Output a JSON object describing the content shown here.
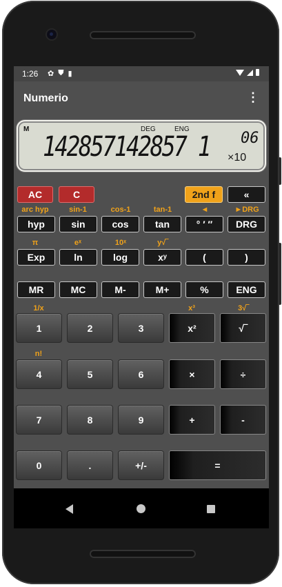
{
  "status": {
    "time": "1:26",
    "icons": [
      "gear-icon",
      "shield-icon",
      "sd-card-icon"
    ]
  },
  "app": {
    "title": "Numerio",
    "menu": "⋮"
  },
  "display": {
    "memory": "M",
    "angle_mode": "DEG",
    "format_mode": "ENG",
    "value": "142857142857 1",
    "exponent": "06",
    "times_ten": "×10"
  },
  "keys": {
    "ac": "AC",
    "c": "C",
    "second_f": "2nd f",
    "backspace": "«",
    "hyp": "hyp",
    "sin": "sin",
    "cos": "cos",
    "tan": "tan",
    "dms": "° ′ ″",
    "drg": "DRG",
    "exp": "Exp",
    "ln": "ln",
    "log": "log",
    "xy": "xʸ",
    "lparen": "(",
    "rparen": ")",
    "mr": "MR",
    "mc": "MC",
    "mminus": "M-",
    "mplus": "M+",
    "percent": "%",
    "eng": "ENG",
    "d1": "1",
    "d2": "2",
    "d3": "3",
    "sq": "x²",
    "sqrt": "√‾",
    "d4": "4",
    "d5": "5",
    "d6": "6",
    "mul": "×",
    "div": "÷",
    "d7": "7",
    "d8": "8",
    "d9": "9",
    "add": "+",
    "sub": "-",
    "d0": "0",
    "dot": ".",
    "neg": "+/-",
    "eq": "="
  },
  "second_labels": {
    "arc_hyp": "arc hyp",
    "sin_inv": "sin-1",
    "cos_inv": "cos-1",
    "tan_inv": "tan-1",
    "dms_back": "◄",
    "drg_to": "►DRG",
    "pi": "π",
    "ex": "eˣ",
    "tenx": "10ˣ",
    "yroot": "y√‾",
    "recip": "1/x",
    "cube": "x³",
    "cuberoot": "3√‾",
    "fact": "n!"
  },
  "colors": {
    "accent": "#f0a21a",
    "ac_red": "#b32b2b",
    "screen_bg": "#4f4f4f"
  }
}
